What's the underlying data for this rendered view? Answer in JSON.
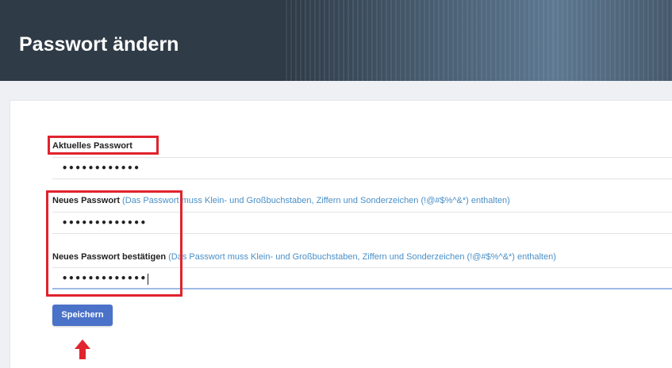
{
  "header": {
    "title": "Passwort ändern"
  },
  "form": {
    "current_password": {
      "label": "Aktuelles Passwort",
      "value": "••••••••••••"
    },
    "new_password": {
      "label": "Neues Passwort",
      "hint": "(Das Passwort muss Klein- und Großbuchstaben, Ziffern und Sonderzeichen (!@#$%^&*) enthalten)",
      "value": "•••••••••••••"
    },
    "confirm_password": {
      "label": "Neues Passwort bestätigen",
      "hint": "(Das Passwort muss Klein- und Großbuchstaben, Ziffern und Sonderzeichen (!@#$%^&*) enthalten)",
      "value": "•••••••••••••"
    },
    "save_label": "Speichern"
  },
  "colors": {
    "annotation": "#e0232d",
    "button": "#4a72c9",
    "hint": "#4a8fc7",
    "header": "#2f3b46"
  }
}
